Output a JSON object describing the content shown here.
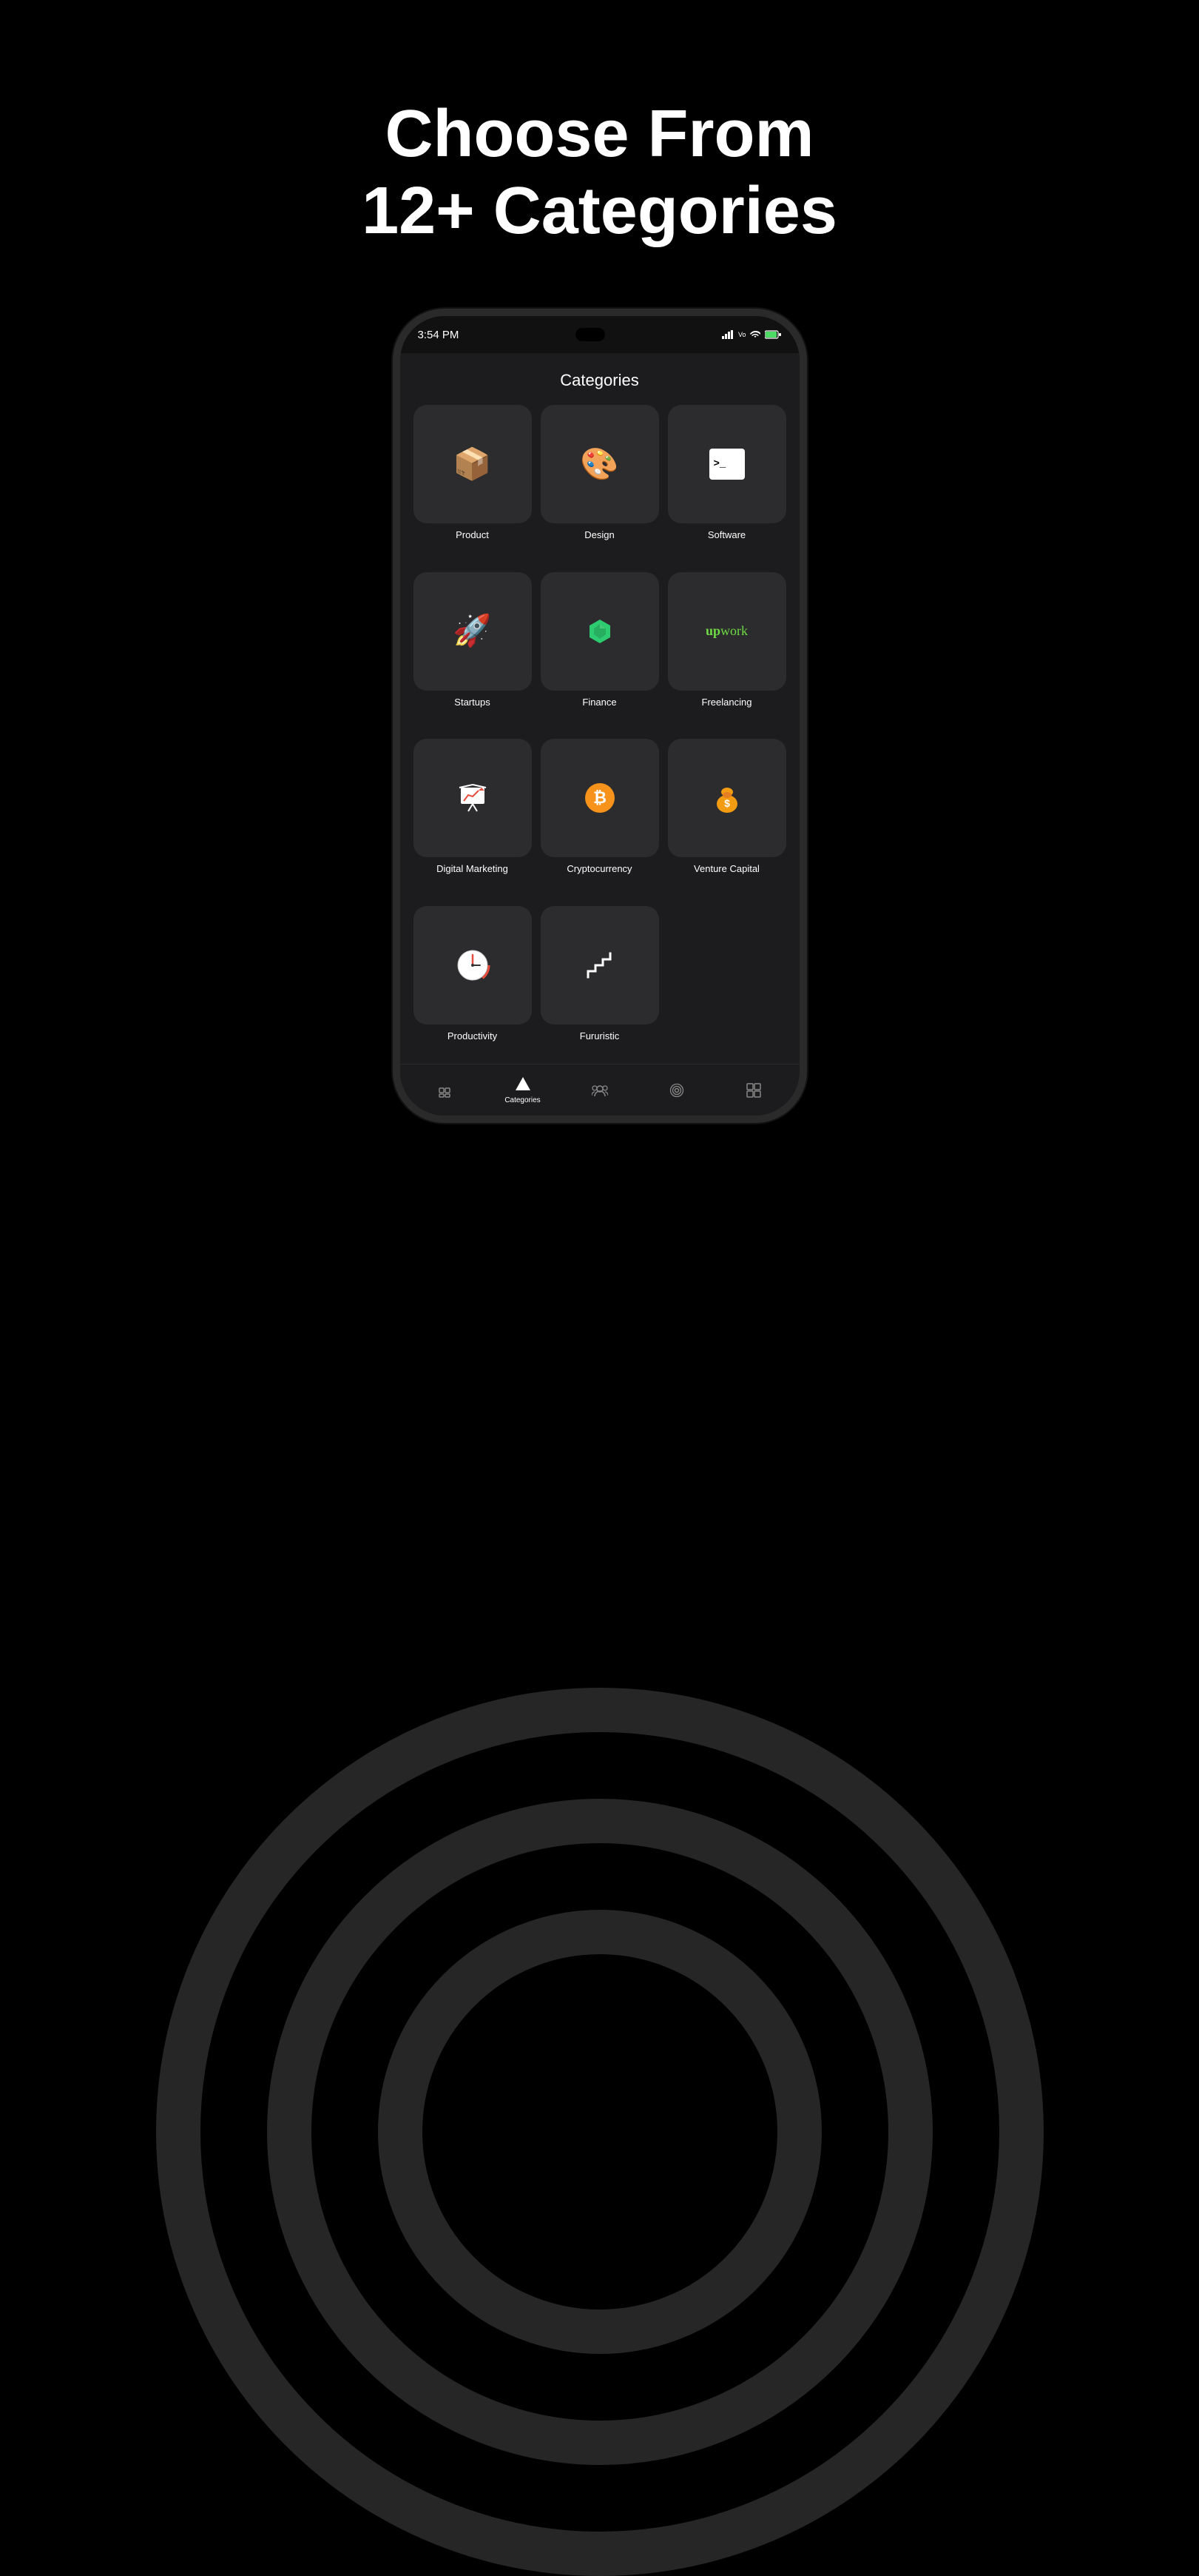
{
  "page": {
    "title": "Choose From 12+ Categories",
    "background": "#000000"
  },
  "phone": {
    "statusBar": {
      "time": "3:54 PM",
      "rightIcons": "signal wifi battery"
    },
    "screen": {
      "title": "Categories",
      "categories": [
        {
          "id": "product",
          "label": "Product",
          "icon": "📦"
        },
        {
          "id": "design",
          "label": "Design",
          "icon": "🎨"
        },
        {
          "id": "software",
          "label": "Software",
          "icon": "terminal"
        },
        {
          "id": "startups",
          "label": "Startups",
          "icon": "🚀"
        },
        {
          "id": "finance",
          "label": "Finance",
          "icon": "finance-gem"
        },
        {
          "id": "freelancing",
          "label": "Freelancing",
          "icon": "upwork"
        },
        {
          "id": "digital-marketing",
          "label": "Digital Marketing",
          "icon": "📊"
        },
        {
          "id": "cryptocurrency",
          "label": "Cryptocurrency",
          "icon": "crypto"
        },
        {
          "id": "venture-capital",
          "label": "Venture Capital",
          "icon": "💰"
        },
        {
          "id": "productivity",
          "label": "Productivity",
          "icon": "clock"
        },
        {
          "id": "futuristic",
          "label": "Fururistic",
          "icon": "stairs"
        }
      ]
    },
    "bottomNav": [
      {
        "id": "home",
        "label": "",
        "active": false,
        "icon": "home-icon"
      },
      {
        "id": "categories",
        "label": "Categories",
        "active": true,
        "icon": "categories-icon"
      },
      {
        "id": "community",
        "label": "",
        "active": false,
        "icon": "community-icon"
      },
      {
        "id": "radio",
        "label": "",
        "active": false,
        "icon": "radio-icon"
      },
      {
        "id": "grid",
        "label": "",
        "active": false,
        "icon": "grid-icon"
      }
    ]
  }
}
